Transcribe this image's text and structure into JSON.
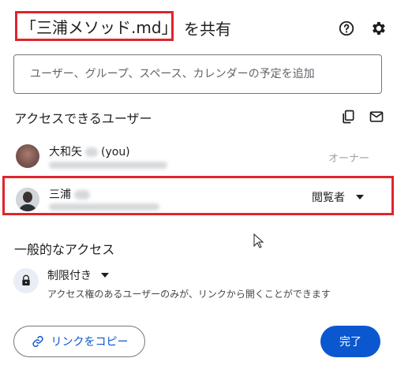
{
  "dialog": {
    "title_file": "「三浦メソッド.md」",
    "title_suffix": "を共有"
  },
  "add_people": {
    "placeholder": "ユーザー、グループ、スペース、カレンダーの予定を追加"
  },
  "people_section": {
    "heading": "アクセスできるユーザー",
    "people": [
      {
        "name": "大和矢",
        "suffix": "(you)",
        "role": "オーナー"
      },
      {
        "name": "三浦",
        "role": "閲覧者"
      }
    ]
  },
  "general_access": {
    "heading": "一般的なアクセス",
    "level": "制限付き",
    "description": "アクセス権のあるユーザーのみが、リンクから開くことができます"
  },
  "footer": {
    "copy_link_label": "リンクをコピー",
    "done_label": "完了"
  },
  "colors": {
    "accent": "#0b57d0",
    "highlight": "#e0252c"
  },
  "icons": [
    "help-icon",
    "gear-icon",
    "copy-icon",
    "mail-icon",
    "lock-icon",
    "link-icon",
    "chevron-down-icon"
  ]
}
